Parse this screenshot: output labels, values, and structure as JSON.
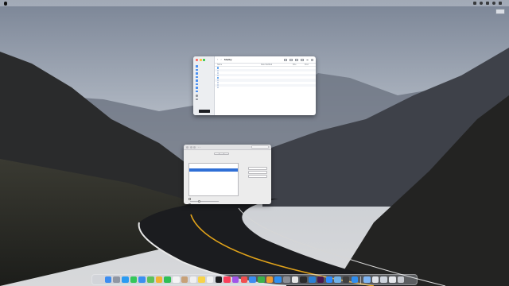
{
  "menubar": {
    "app_name": "",
    "menus": [
      "",
      "",
      "",
      "",
      "",
      ""
    ],
    "clock": ""
  },
  "desktop_widget": {
    "label": ""
  },
  "finder": {
    "title": "Shelby",
    "sidebar": {
      "sections": [
        {
          "header": "",
          "items": [
            "",
            "",
            "",
            "",
            "",
            "",
            "",
            ""
          ]
        },
        {
          "header": "",
          "items": [
            "",
            ""
          ]
        }
      ]
    },
    "columns": {
      "name": "Name",
      "date": "Date Modified",
      "size": "Size",
      "kind": "Kind"
    },
    "rows": [
      {
        "name": "",
        "date": "",
        "size": "",
        "kind": "",
        "icon": "folder-icon"
      },
      {
        "name": "",
        "date": "",
        "size": "",
        "kind": "",
        "icon": "file-icon"
      },
      {
        "name": "",
        "date": "",
        "size": "",
        "kind": "",
        "icon": "file-icon"
      },
      {
        "name": "",
        "date": "",
        "size": "",
        "kind": "",
        "icon": "file-icon"
      },
      {
        "name": "",
        "date": "",
        "size": "",
        "kind": "",
        "icon": "folder-icon"
      },
      {
        "name": "",
        "date": "",
        "size": "",
        "kind": "",
        "icon": "file-icon"
      },
      {
        "name": "",
        "date": "",
        "size": "",
        "kind": "",
        "icon": "file-icon"
      },
      {
        "name": "",
        "date": "",
        "size": "",
        "kind": "",
        "icon": "file-icon"
      },
      {
        "name": "",
        "date": "",
        "size": "",
        "kind": "",
        "icon": "file-icon"
      }
    ]
  },
  "dialog": {
    "title": "",
    "search_placeholder": "",
    "tabs": [
      "",
      "",
      ""
    ],
    "active_tab": 0,
    "list_label": "",
    "list_items": [
      "",
      "",
      ""
    ],
    "selected_index": 2,
    "buttons": [
      "",
      "",
      ""
    ],
    "checkbox_label": "",
    "slider_label": "",
    "footer_text": ""
  },
  "dock": {
    "apps": [
      {
        "icon": "finder-icon",
        "color": "#3d8df0"
      },
      {
        "icon": "launchpad-icon",
        "color": "#8f96a3"
      },
      {
        "icon": "safari-icon",
        "color": "#2a9bf2"
      },
      {
        "icon": "messages-icon",
        "color": "#34c759"
      },
      {
        "icon": "mail-icon",
        "color": "#3b8ff0"
      },
      {
        "icon": "maps-icon",
        "color": "#5cc15a"
      },
      {
        "icon": "photos-icon",
        "color": "#f2b233"
      },
      {
        "icon": "facetime-icon",
        "color": "#2fbf54"
      },
      {
        "icon": "calendar-icon",
        "color": "#f4f4f4"
      },
      {
        "icon": "contacts-icon",
        "color": "#c7a178"
      },
      {
        "icon": "reminders-icon",
        "color": "#f0f0f0"
      },
      {
        "icon": "notes-icon",
        "color": "#f7d34a"
      },
      {
        "icon": "freeform-icon",
        "color": "#f2f2f2"
      },
      {
        "icon": "tv-icon",
        "color": "#1d1d1f"
      },
      {
        "icon": "music-icon",
        "color": "#fa3f5b"
      },
      {
        "icon": "podcasts-icon",
        "color": "#a154e8"
      },
      {
        "icon": "news-icon",
        "color": "#f24e4e"
      },
      {
        "icon": "keynote-icon",
        "color": "#3a8cf2"
      },
      {
        "icon": "numbers-icon",
        "color": "#3bb34a"
      },
      {
        "icon": "pages-icon",
        "color": "#f29b2e"
      },
      {
        "icon": "app-store-icon",
        "color": "#2d8ff2"
      },
      {
        "icon": "system-settings-icon",
        "color": "#8c8f96"
      },
      {
        "icon": "chrome-icon",
        "color": "#e7e7e7"
      },
      {
        "icon": "terminal-icon",
        "color": "#2b2b2b"
      },
      {
        "icon": "vscode-icon",
        "color": "#2a7fd4"
      },
      {
        "icon": "slack-icon",
        "color": "#4a154b"
      },
      {
        "icon": "zoom-icon",
        "color": "#2d8cff"
      },
      {
        "icon": "preview-icon",
        "color": "#6fb1e8"
      },
      {
        "icon": "activity-monitor-icon",
        "color": "#3f3f3f"
      },
      {
        "icon": "xcode-icon",
        "color": "#2f8ef0"
      }
    ],
    "recent": [
      {
        "icon": "downloads-stack-icon",
        "color": "#7fb6f5"
      },
      {
        "icon": "window-thumbnail-icon",
        "color": "#dfe3e9"
      },
      {
        "icon": "window-thumbnail-icon",
        "color": "#cfd5de"
      },
      {
        "icon": "window-thumbnail-icon",
        "color": "#e6e8ec"
      }
    ],
    "trash": {
      "icon": "trash-icon",
      "color": "#c9ccd2"
    }
  },
  "colors": {
    "accent": "#2f6fd6",
    "sky_top": "#7d8799",
    "road": "#1b1c1f",
    "road_line": "#e0a21a"
  }
}
